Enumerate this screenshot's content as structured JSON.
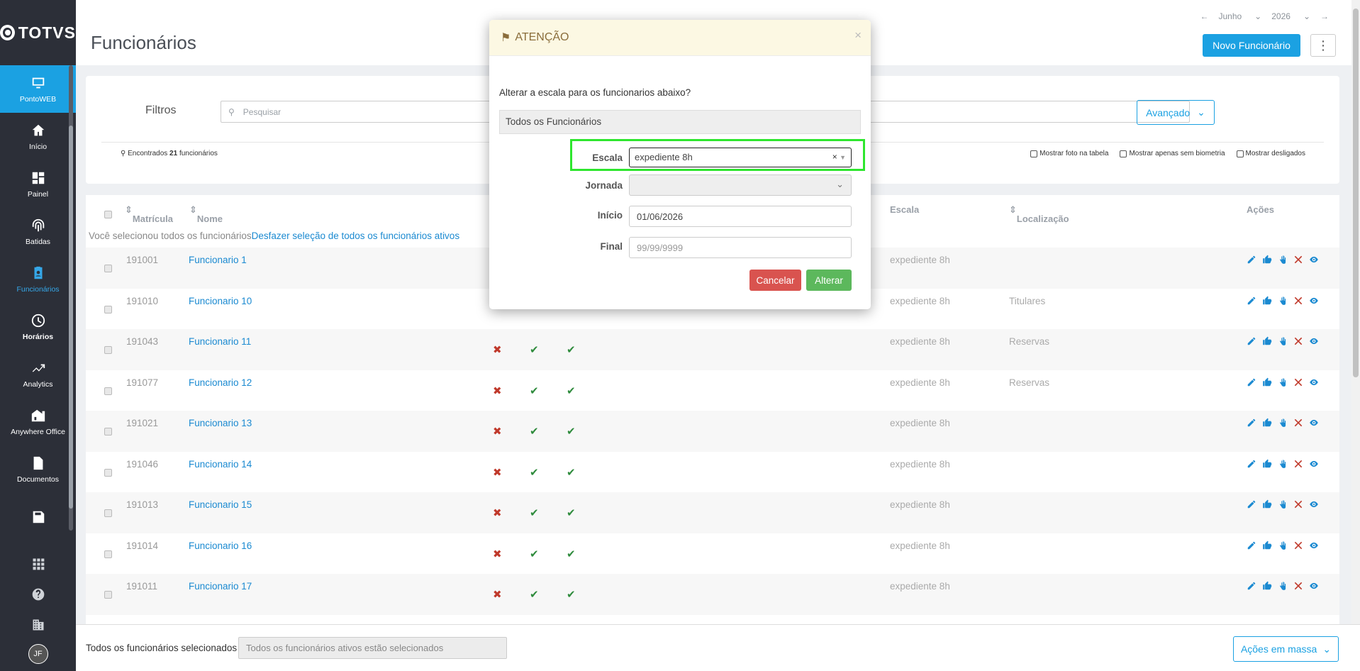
{
  "app": {
    "logo_text": "TOTVS"
  },
  "sidebar": {
    "items": [
      {
        "label": "PontoWEB",
        "icon": "monitor-icon"
      },
      {
        "label": "Início",
        "icon": "home-icon"
      },
      {
        "label": "Painel",
        "icon": "dashboard-icon"
      },
      {
        "label": "Batidas",
        "icon": "fingerprint-icon"
      },
      {
        "label": "Funcionários",
        "icon": "badge-icon"
      },
      {
        "label": "Horários",
        "icon": "clock-icon"
      },
      {
        "label": "Analytics",
        "icon": "trend-icon"
      },
      {
        "label": "Anywhere Office",
        "icon": "home-office-icon"
      },
      {
        "label": "Documentos",
        "icon": "document-icon"
      }
    ],
    "avatar_initials": "JF"
  },
  "header": {
    "title": "Funcionários",
    "month": "Junho",
    "year": "2026",
    "new_button": "Novo Funcionário"
  },
  "filters": {
    "label": "Filtros",
    "search_placeholder": "Pesquisar",
    "advanced": "Avançado",
    "found_prefix": "Encontrados",
    "found_count": "21",
    "found_suffix": "funcionários",
    "show_photo": "Mostrar foto na tabela",
    "show_no_bio": "Mostrar apenas sem biometria",
    "show_off": "Mostrar desligados"
  },
  "table": {
    "columns": {
      "matricula": "Matrícula",
      "nome": "Nome",
      "escala": "Escala",
      "localizacao": "Localização",
      "acoes": "Ações"
    },
    "selection_text": "Você selecionou todos os funcionários",
    "selection_link": "Desfazer seleção de todos os funcionários ativos",
    "rows": [
      {
        "mat": "191001",
        "nome": "Funcionario 1",
        "escala": "expediente 8h",
        "loc": ""
      },
      {
        "mat": "191010",
        "nome": "Funcionario 10",
        "escala": "expediente 8h",
        "loc": "Titulares"
      },
      {
        "mat": "191043",
        "nome": "Funcionario 11",
        "escala": "expediente 8h",
        "loc": "Reservas"
      },
      {
        "mat": "191077",
        "nome": "Funcionario 12",
        "escala": "expediente 8h",
        "loc": "Reservas"
      },
      {
        "mat": "191021",
        "nome": "Funcionario 13",
        "escala": "expediente 8h",
        "loc": ""
      },
      {
        "mat": "191046",
        "nome": "Funcionario 14",
        "escala": "expediente 8h",
        "loc": ""
      },
      {
        "mat": "191013",
        "nome": "Funcionario 15",
        "escala": "expediente 8h",
        "loc": ""
      },
      {
        "mat": "191014",
        "nome": "Funcionario 16",
        "escala": "expediente 8h",
        "loc": ""
      },
      {
        "mat": "191011",
        "nome": "Funcionario 17",
        "escala": "expediente 8h",
        "loc": ""
      }
    ]
  },
  "footer": {
    "label": "Todos os funcionários selecionados",
    "field_value": "Todos os funcionários ativos estão selecionados",
    "mass_actions": "Ações em massa"
  },
  "modal": {
    "title": "ATENÇÃO",
    "close": "×",
    "question": "Alterar a escala para os funcionarios abaixo?",
    "target": "Todos os Funcionários",
    "escala_label": "Escala",
    "escala_value": "expediente 8h",
    "jornada_label": "Jornada",
    "inicio_label": "Início",
    "inicio_value": "01/06/2026",
    "final_label": "Final",
    "final_placeholder": "99/99/9999",
    "cancel": "Cancelar",
    "confirm": "Alterar"
  },
  "colors": {
    "accent": "#1ba1e2",
    "sidebar": "#2c2f38",
    "danger": "#d9534f",
    "success": "#5cb85c",
    "highlight": "#2ee62e"
  }
}
